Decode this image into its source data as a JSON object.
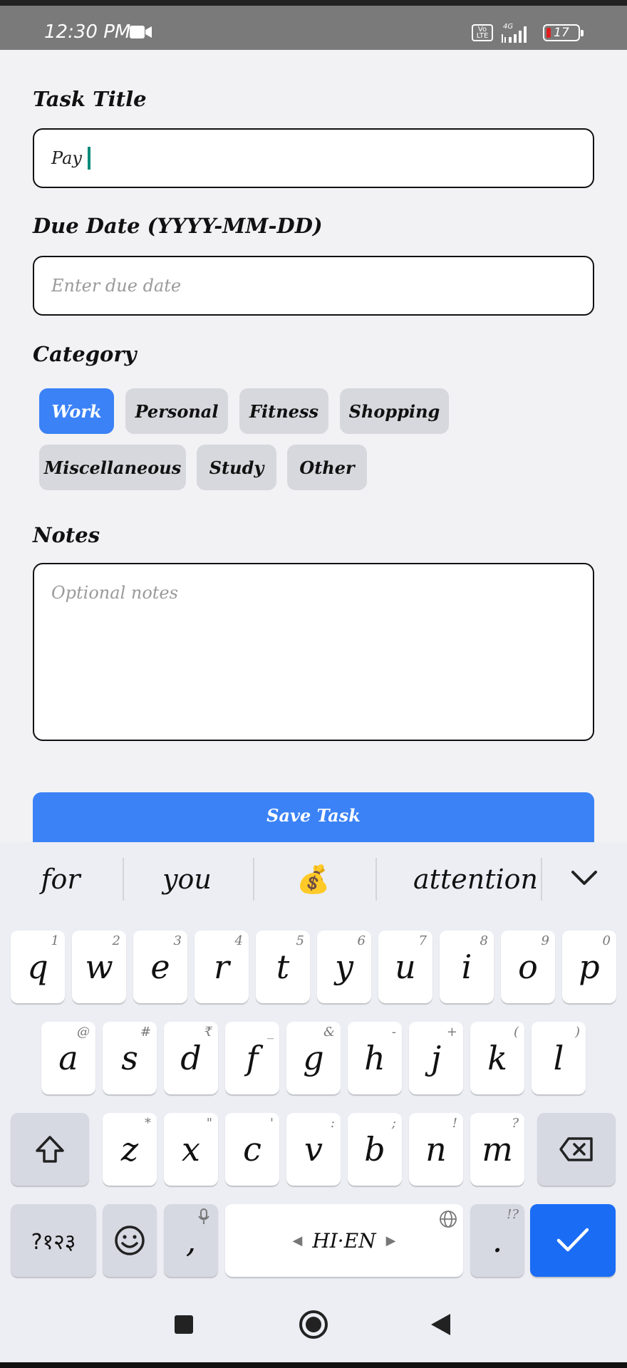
{
  "status_bar": {
    "time": "12:30 PM",
    "volte": "Vo LTE",
    "network": "4G",
    "battery": "17"
  },
  "form": {
    "title_label": "Task Title",
    "title_value": "Pay",
    "due_label": "Due Date (YYYY-MM-DD)",
    "due_placeholder": "Enter due date",
    "category_label": "Category",
    "categories": [
      {
        "label": "Work",
        "selected": true
      },
      {
        "label": "Personal",
        "selected": false
      },
      {
        "label": "Fitness",
        "selected": false
      },
      {
        "label": "Shopping",
        "selected": false
      },
      {
        "label": "Miscellaneous",
        "selected": false
      },
      {
        "label": "Study",
        "selected": false
      },
      {
        "label": "Other",
        "selected": false
      }
    ],
    "notes_label": "Notes",
    "notes_placeholder": "Optional notes",
    "save_label": "Save Task"
  },
  "keyboard": {
    "suggestions": [
      "for",
      "you",
      "💰",
      "attention"
    ],
    "row1": [
      {
        "k": "q",
        "h": "1"
      },
      {
        "k": "w",
        "h": "2"
      },
      {
        "k": "e",
        "h": "3"
      },
      {
        "k": "r",
        "h": "4"
      },
      {
        "k": "t",
        "h": "5"
      },
      {
        "k": "y",
        "h": "6"
      },
      {
        "k": "u",
        "h": "7"
      },
      {
        "k": "i",
        "h": "8"
      },
      {
        "k": "o",
        "h": "9"
      },
      {
        "k": "p",
        "h": "0"
      }
    ],
    "row2": [
      {
        "k": "a",
        "h": "@"
      },
      {
        "k": "s",
        "h": "#"
      },
      {
        "k": "d",
        "h": "₹"
      },
      {
        "k": "f",
        "h": "_"
      },
      {
        "k": "g",
        "h": "&"
      },
      {
        "k": "h",
        "h": "-"
      },
      {
        "k": "j",
        "h": "+"
      },
      {
        "k": "k",
        "h": "("
      },
      {
        "k": "l",
        "h": ")"
      }
    ],
    "row3": [
      {
        "k": "z",
        "h": "*"
      },
      {
        "k": "x",
        "h": "\""
      },
      {
        "k": "c",
        "h": "'"
      },
      {
        "k": "v",
        "h": ":"
      },
      {
        "k": "b",
        "h": ";"
      },
      {
        "k": "n",
        "h": "!"
      },
      {
        "k": "m",
        "h": "?"
      }
    ],
    "symbols_label": "?१२३",
    "comma": ",",
    "space_label": "HI·EN",
    "period": ".",
    "period_hint": "!?",
    "colors": {
      "accent": "#1a6cf5",
      "key": "#ffffff",
      "key_gray": "#d6d9e2"
    }
  },
  "colors": {
    "primary": "#3b82f6",
    "caret": "#0b8a7a"
  }
}
